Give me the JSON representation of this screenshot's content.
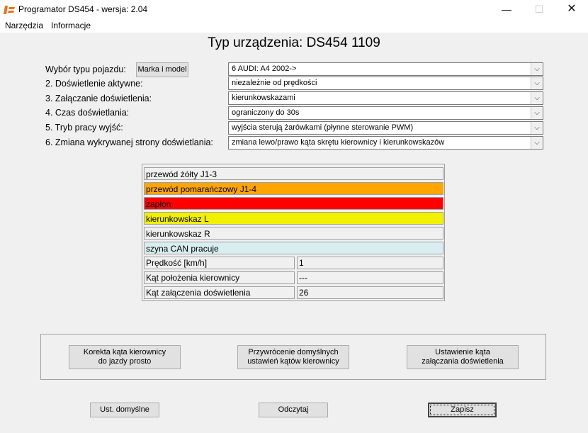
{
  "window": {
    "title": "Programator DS454 - wersja:  2.04",
    "minimize": "—",
    "maximize": "☐",
    "close": "✕"
  },
  "menu": [
    "Narzędzia",
    "Informacje"
  ],
  "heading": "Typ urządzenia:  DS454 1109",
  "vehicle_button": "Marka i model",
  "settings": [
    {
      "label": "Wybór typu pojazdu:",
      "value": "6 AUDI: A4 2002->"
    },
    {
      "label": "2. Doświetlenie aktywne:",
      "value": "niezależnie od prędkości"
    },
    {
      "label": "3. Załączanie doświetlenia:",
      "value": "kierunkowskazami"
    },
    {
      "label": "4. Czas doświetlania:",
      "value": "ograniczony do 30s"
    },
    {
      "label": "5. Tryb pracy wyjść:",
      "value": "wyjścia sterują żarówkami (płynne sterowanie PWM)"
    },
    {
      "label": "6. Zmiana wykrywanej strony doświetlania:",
      "value": "zmiana lewo/prawo kąta skrętu kierownicy i kierunkowskazów"
    }
  ],
  "signals": [
    {
      "label": "przewód żółty J1-3",
      "color": "#f0f0f0"
    },
    {
      "label": "przewód pomarańczowy J1-4",
      "color": "#ffa500"
    },
    {
      "label": "zapłon",
      "color": "#ff0000"
    },
    {
      "label": "kierunkowskaz L",
      "color": "#f0f000"
    },
    {
      "label": "kierunkowskaz R",
      "color": "#f0f0f0"
    },
    {
      "label": "szyna CAN pracuje",
      "color": "#d8eef0"
    }
  ],
  "readouts": [
    {
      "label": "Prędkość [km/h]",
      "value": "1"
    },
    {
      "label": "Kąt położenia kierownicy",
      "value": "---"
    },
    {
      "label": "Kąt załączenia doświetlenia",
      "value": "26"
    }
  ],
  "group_buttons": [
    {
      "line1": "Korekta kąta kierownicy",
      "line2": "do jazdy prosto"
    },
    {
      "line1": "Przywrócenie domyślnych",
      "line2": "ustawień kątów kierownicy"
    },
    {
      "line1": "Ustawienie kąta",
      "line2": "załączania doświetlenia"
    }
  ],
  "bottom_buttons": {
    "defaults": "Ust. domyślne",
    "read": "Odczytaj",
    "save": "Zapisz"
  },
  "colors": {
    "accent": "#e8731c"
  }
}
